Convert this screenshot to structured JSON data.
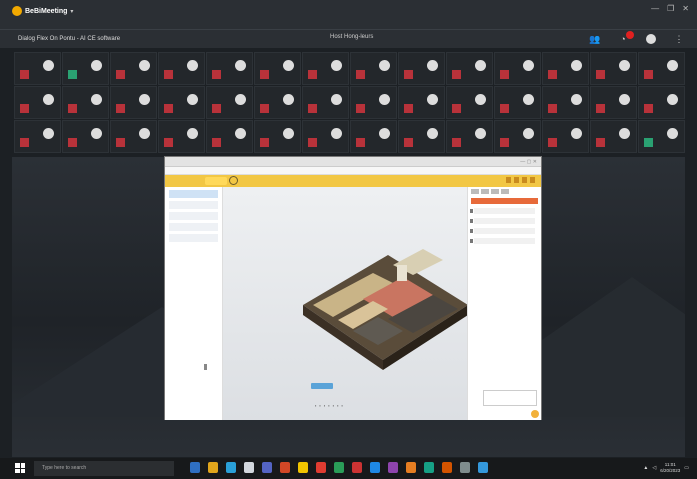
{
  "app": {
    "brand": "BeBiMeeting",
    "meeting_subtitle": "Dialog Flex On Pontu - AI CE software",
    "center_title": "Host Hong-leurs",
    "window_controls": [
      "—",
      "❐",
      "✕"
    ]
  },
  "top_right": {
    "icons": [
      "people-icon",
      "bell-icon",
      "avatar",
      "more-icon"
    ]
  },
  "participants": {
    "rows": 3,
    "columns": 14,
    "tiles": [
      {
        "sq": "red",
        "circ": true
      },
      {
        "sq": "green",
        "circ": true
      },
      {
        "sq": "red",
        "circ": true
      },
      {
        "sq": "red",
        "circ": true
      },
      {
        "sq": "red",
        "circ": true
      },
      {
        "sq": "red",
        "circ": true
      },
      {
        "sq": "red",
        "circ": true
      },
      {
        "sq": "red",
        "circ": true
      },
      {
        "sq": "red",
        "circ": true
      },
      {
        "sq": "red",
        "circ": true
      },
      {
        "sq": "red",
        "circ": true
      },
      {
        "sq": "red",
        "circ": true
      },
      {
        "sq": "red",
        "circ": true
      },
      {
        "sq": "red",
        "circ": true
      },
      {
        "sq": "red",
        "circ": true
      },
      {
        "sq": "red",
        "circ": true
      },
      {
        "sq": "red",
        "circ": true
      },
      {
        "sq": "red",
        "circ": true
      },
      {
        "sq": "red",
        "circ": true
      },
      {
        "sq": "red",
        "circ": true
      },
      {
        "sq": "red",
        "circ": true
      },
      {
        "sq": "red",
        "circ": true
      },
      {
        "sq": "red",
        "circ": true
      },
      {
        "sq": "red",
        "circ": true
      },
      {
        "sq": "red",
        "circ": true
      },
      {
        "sq": "red",
        "circ": true
      },
      {
        "sq": "red",
        "circ": true
      },
      {
        "sq": "red",
        "circ": true
      },
      {
        "sq": "red",
        "circ": true
      },
      {
        "sq": "red",
        "circ": true
      },
      {
        "sq": "red",
        "circ": true
      },
      {
        "sq": "red",
        "circ": true
      },
      {
        "sq": "red",
        "circ": true
      },
      {
        "sq": "red",
        "circ": true
      },
      {
        "sq": "red",
        "circ": true
      },
      {
        "sq": "red",
        "circ": true
      },
      {
        "sq": "red",
        "circ": true
      },
      {
        "sq": "red",
        "circ": true
      },
      {
        "sq": "red",
        "circ": true
      },
      {
        "sq": "red",
        "circ": true
      },
      {
        "sq": "red",
        "circ": true
      },
      {
        "sq": "green",
        "circ": true
      }
    ]
  },
  "taskbar": {
    "search_placeholder": "Type here to search",
    "clock_time": "11:01",
    "clock_date": "6/20/2023",
    "icons": [
      "edge-icon",
      "file-explorer-icon",
      "store-icon",
      "mail-icon",
      "teams-icon",
      "office-icon",
      "chrome-icon",
      "app-icon",
      "app-icon",
      "app-icon",
      "app-icon",
      "app-icon",
      "app-icon",
      "app-icon",
      "app-icon",
      "app-icon",
      "app-icon"
    ]
  },
  "colors": {
    "accent_yellow": "#f2c744",
    "tile_red": "#b8323a",
    "tile_green": "#2aa172"
  }
}
